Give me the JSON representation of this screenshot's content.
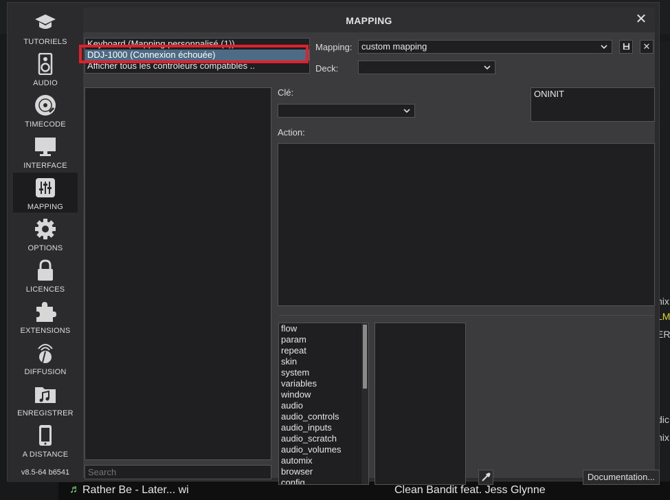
{
  "background": {
    "right_texts": [
      "nix",
      "LM",
      "ER",
      "dic",
      "nix"
    ],
    "now_playing": {
      "title": "Rather Be  - Later... wi",
      "artist": "Clean Bandit feat. Jess Glynne"
    }
  },
  "sidebar": {
    "items": [
      {
        "label": "TUTORIELS",
        "icon": "graduation-cap-icon"
      },
      {
        "label": "AUDIO",
        "icon": "speaker-icon"
      },
      {
        "label": "TIMECODE",
        "icon": "vinyl-disc-icon"
      },
      {
        "label": "INTERFACE",
        "icon": "monitor-icon"
      },
      {
        "label": "MAPPING",
        "icon": "sliders-icon",
        "active": true
      },
      {
        "label": "OPTIONS",
        "icon": "gear-icon"
      },
      {
        "label": "LICENCES",
        "icon": "lock-icon"
      },
      {
        "label": "EXTENSIONS",
        "icon": "puzzle-icon"
      },
      {
        "label": "DIFFUSION",
        "icon": "broadcast-dish-icon"
      },
      {
        "label": "ENREGISTRER",
        "icon": "music-folder-icon"
      },
      {
        "label": "A DISTANCE",
        "icon": "phone-icon"
      }
    ],
    "version": "v8.5-64 b6541"
  },
  "dialog": {
    "title": "MAPPING",
    "devices": [
      "Keyboard (Mapping personnalisé (1))",
      "DDJ-1000 (Connexion échouée)",
      "Afficher tous les contrôleurs compatibles .."
    ],
    "selected_device_index": 1,
    "mapping_label": "Mapping:",
    "mapping_value": "custom mapping",
    "deck_label": "Deck:",
    "deck_value": "",
    "key_label": "Clé:",
    "key_value": "",
    "action_label": "Action:",
    "event_text": "ONINIT",
    "search_placeholder": "Search",
    "categories": [
      "flow",
      "param",
      "repeat",
      "skin",
      "system",
      "variables",
      "window",
      "audio",
      "audio_controls",
      "audio_inputs",
      "audio_scratch",
      "audio_volumes",
      "automix",
      "browser",
      "config"
    ],
    "documentation_label": "Documentation...",
    "close_glyph": "✕",
    "delete_glyph": "✕"
  },
  "colors": {
    "selection": "#4e6b86",
    "highlight_box": "#e0202a",
    "panel_bg": "#1f1f21"
  }
}
